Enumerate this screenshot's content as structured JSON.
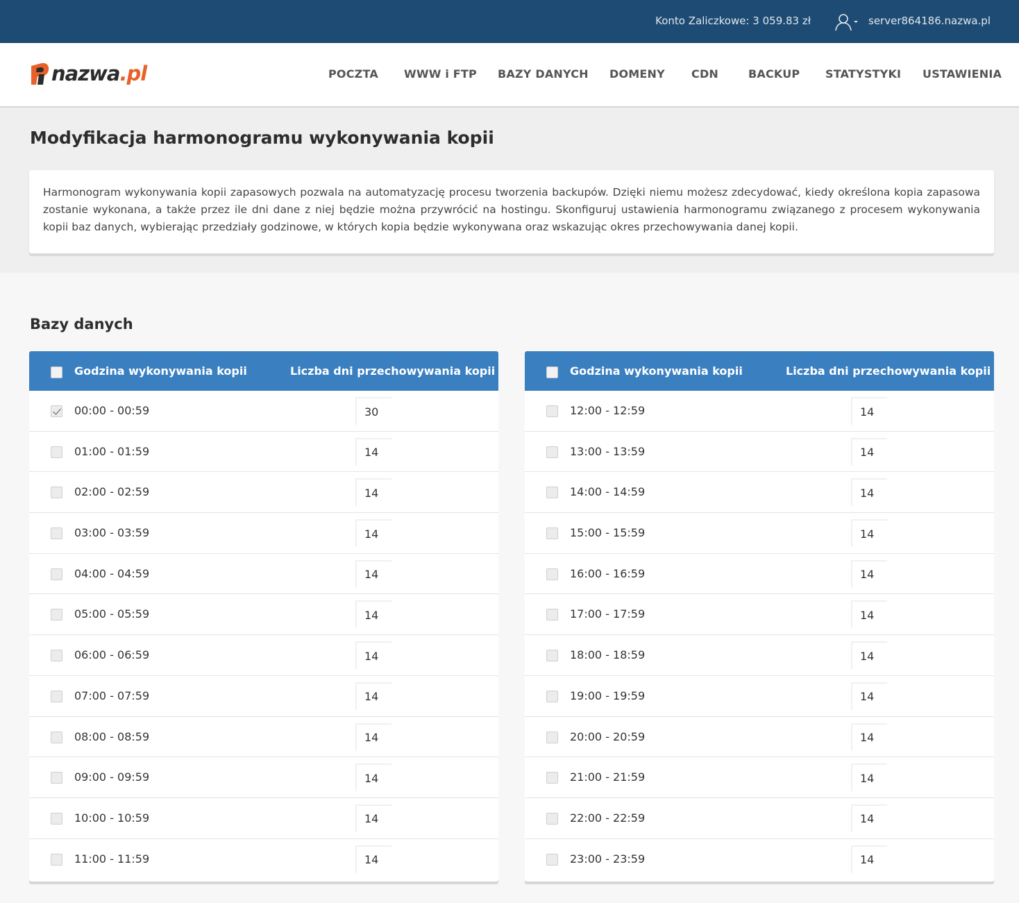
{
  "topbar": {
    "account_label": "Konto Zaliczkowe: 3 059.83 zł",
    "server_name": "server864186.nazwa.pl"
  },
  "logo": {
    "text_main": "nazwa",
    "text_suffix": ".pl",
    "brand_color": "#e8612a"
  },
  "nav": [
    "POCZTA",
    "WWW i FTP",
    "BAZY DANYCH",
    "DOMENY",
    "CDN",
    "BACKUP",
    "STATYSTYKI",
    "USTAWIENIA"
  ],
  "page": {
    "title": "Modyfikacja harmonogramu wykonywania kopii",
    "description": "Harmonogram wykonywania kopii zapasowych pozwala na automatyzację procesu tworzenia backupów. Dzięki niemu możesz zdecydować, kiedy określona kopia zapasowa zostanie wykonana, a także przez ile dni dane z niej będzie można przywrócić na hostingu. Skonfiguruj ustawienia harmonogramu związanego z procesem wykonywania kopii baz danych, wybierając przedziały godzinowe, w których kopia będzie wykonywana oraz wskazując okres przechowywania danej kopii."
  },
  "section": {
    "title": "Bazy danych"
  },
  "table": {
    "col_hour": "Godzina wykonywania kopii",
    "col_days": "Liczba dni przechowywania kopii",
    "header_color": "#3a7fc0",
    "left_rows": [
      {
        "hour": "00:00 - 00:59",
        "days": "30",
        "checked": true
      },
      {
        "hour": "01:00 - 01:59",
        "days": "14",
        "checked": false
      },
      {
        "hour": "02:00 - 02:59",
        "days": "14",
        "checked": false
      },
      {
        "hour": "03:00 - 03:59",
        "days": "14",
        "checked": false
      },
      {
        "hour": "04:00 - 04:59",
        "days": "14",
        "checked": false
      },
      {
        "hour": "05:00 - 05:59",
        "days": "14",
        "checked": false
      },
      {
        "hour": "06:00 - 06:59",
        "days": "14",
        "checked": false
      },
      {
        "hour": "07:00 - 07:59",
        "days": "14",
        "checked": false
      },
      {
        "hour": "08:00 - 08:59",
        "days": "14",
        "checked": false
      },
      {
        "hour": "09:00 - 09:59",
        "days": "14",
        "checked": false
      },
      {
        "hour": "10:00 - 10:59",
        "days": "14",
        "checked": false
      },
      {
        "hour": "11:00 - 11:59",
        "days": "14",
        "checked": false
      }
    ],
    "right_rows": [
      {
        "hour": "12:00 - 12:59",
        "days": "14",
        "checked": false
      },
      {
        "hour": "13:00 - 13:59",
        "days": "14",
        "checked": false
      },
      {
        "hour": "14:00 - 14:59",
        "days": "14",
        "checked": false
      },
      {
        "hour": "15:00 - 15:59",
        "days": "14",
        "checked": false
      },
      {
        "hour": "16:00 - 16:59",
        "days": "14",
        "checked": false
      },
      {
        "hour": "17:00 - 17:59",
        "days": "14",
        "checked": false
      },
      {
        "hour": "18:00 - 18:59",
        "days": "14",
        "checked": false
      },
      {
        "hour": "19:00 - 19:59",
        "days": "14",
        "checked": false
      },
      {
        "hour": "20:00 - 20:59",
        "days": "14",
        "checked": false
      },
      {
        "hour": "21:00 - 21:59",
        "days": "14",
        "checked": false
      },
      {
        "hour": "22:00 - 22:59",
        "days": "14",
        "checked": false
      },
      {
        "hour": "23:00 - 23:59",
        "days": "14",
        "checked": false
      }
    ]
  }
}
